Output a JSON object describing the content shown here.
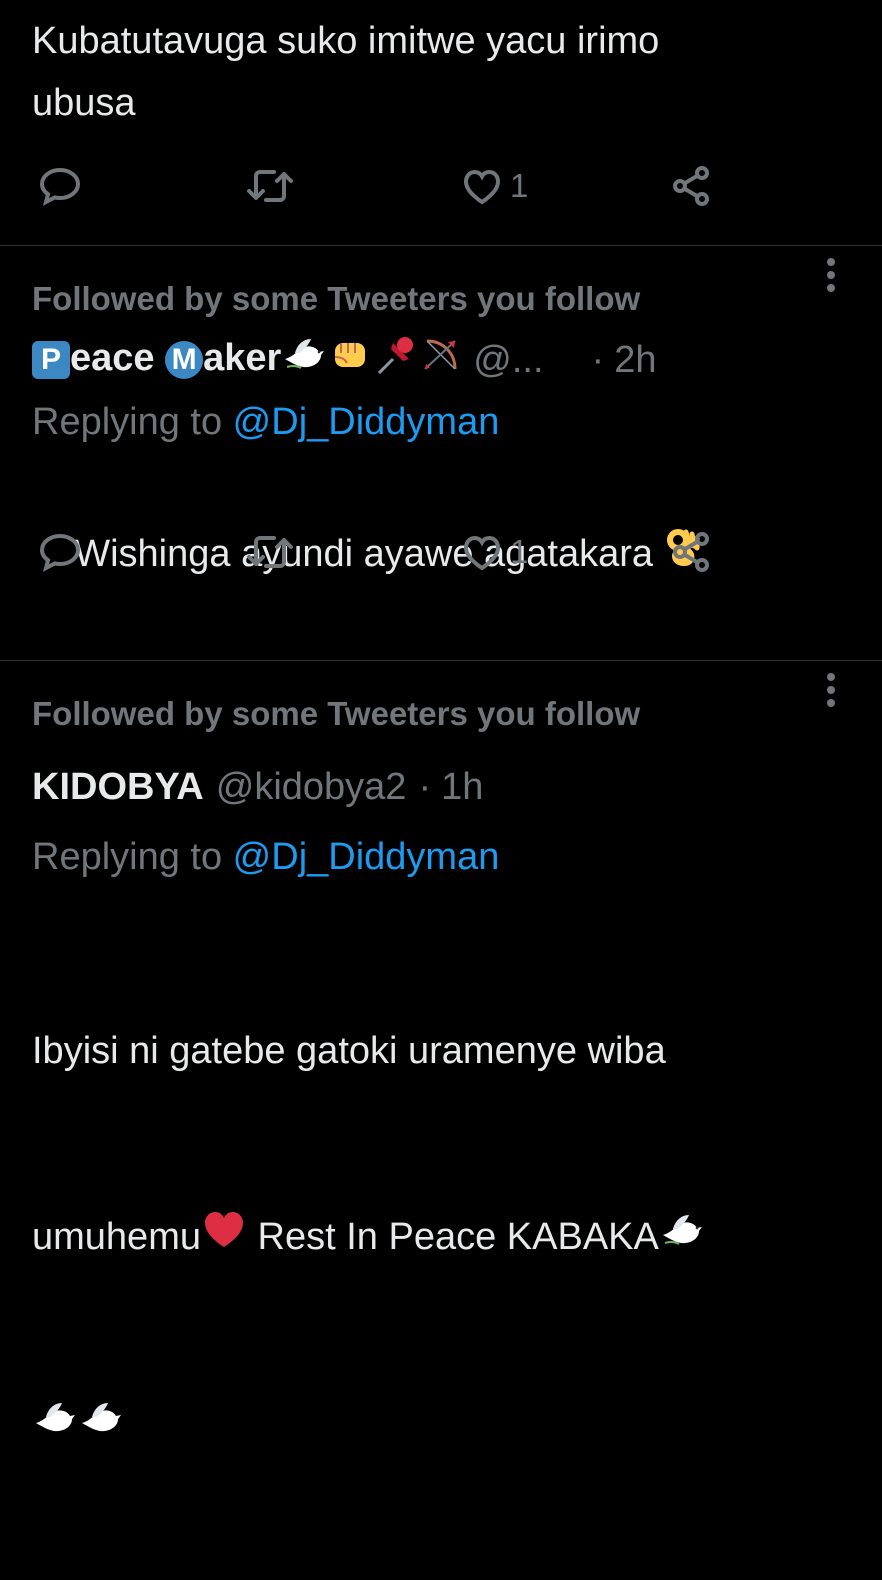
{
  "tweets": [
    {
      "text": "Kubatutavuga suko imitwe yacu irimo\nubusa",
      "like_count": "1"
    },
    {
      "social_context": "Followed by some Tweeters you follow",
      "name_badge_1": "P",
      "name_part_1": "eace ",
      "name_badge_2": "M",
      "name_part_2": "aker",
      "handle": "@...",
      "dot": "·",
      "time": "2h",
      "replying_prefix": "Replying to ",
      "replying_handle": "@Dj_Diddyman",
      "text": "Wishinga ayundi ayawe agatakara ",
      "like_count": "1"
    },
    {
      "social_context": "Followed by some Tweeters you follow",
      "name": "KIDOBYA",
      "handle": "@kidobya2",
      "dot": "·",
      "time": "1h",
      "replying_prefix": "Replying to ",
      "replying_handle": "@Dj_Diddyman",
      "text_line_1": "Ibyisi ni gatebe gatoki uramenye wiba",
      "text_line_2_a": "umuhemu",
      "text_line_2_b": " Rest In Peace KABAKA"
    }
  ],
  "icons": {
    "reply": "reply-icon",
    "retweet": "retweet-icon",
    "like": "heart-icon",
    "share": "share-icon",
    "more": "more-icon"
  },
  "colors": {
    "background": "#000000",
    "text": "#e7e9ea",
    "secondary": "#71767b",
    "link": "#1d9bf0",
    "divider": "#2f3336",
    "badge": "#3b88c3"
  }
}
